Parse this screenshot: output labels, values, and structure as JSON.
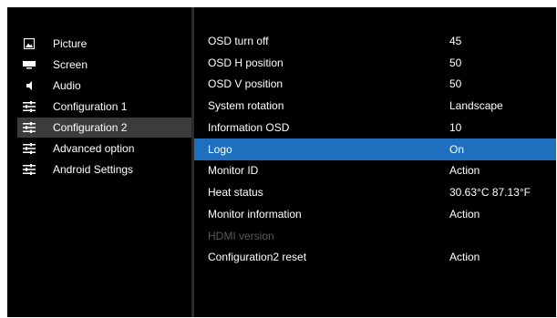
{
  "sidebar": {
    "items": [
      {
        "label": "Picture",
        "icon": "picture-icon"
      },
      {
        "label": "Screen",
        "icon": "screen-icon"
      },
      {
        "label": "Audio",
        "icon": "speaker-icon"
      },
      {
        "label": "Configuration 1",
        "icon": "sliders-icon"
      },
      {
        "label": "Configuration 2",
        "icon": "sliders-icon",
        "selected": true
      },
      {
        "label": "Advanced option",
        "icon": "sliders-icon"
      },
      {
        "label": "Android Settings",
        "icon": "sliders-icon"
      }
    ]
  },
  "settings": {
    "rows": [
      {
        "label": "OSD turn off",
        "value": "45"
      },
      {
        "label": "OSD H position",
        "value": "50"
      },
      {
        "label": "OSD V position",
        "value": "50"
      },
      {
        "label": "System rotation",
        "value": "Landscape"
      },
      {
        "label": "Information OSD",
        "value": "10"
      },
      {
        "label": "Logo",
        "value": "On",
        "highlighted": true
      },
      {
        "label": "Monitor ID",
        "value": "Action"
      },
      {
        "label": "Heat status",
        "value": "30.63°C 87.13°F"
      },
      {
        "label": "Monitor information",
        "value": "Action"
      },
      {
        "label": "HDMI version",
        "value": "",
        "disabled": true
      },
      {
        "label": "Configuration2 reset",
        "value": "Action"
      }
    ]
  },
  "colors": {
    "background": "#000000",
    "highlight": "#1e6fbe",
    "sidebar_selected": "#3c3c3c",
    "disabled_text": "#5a5a5a"
  }
}
